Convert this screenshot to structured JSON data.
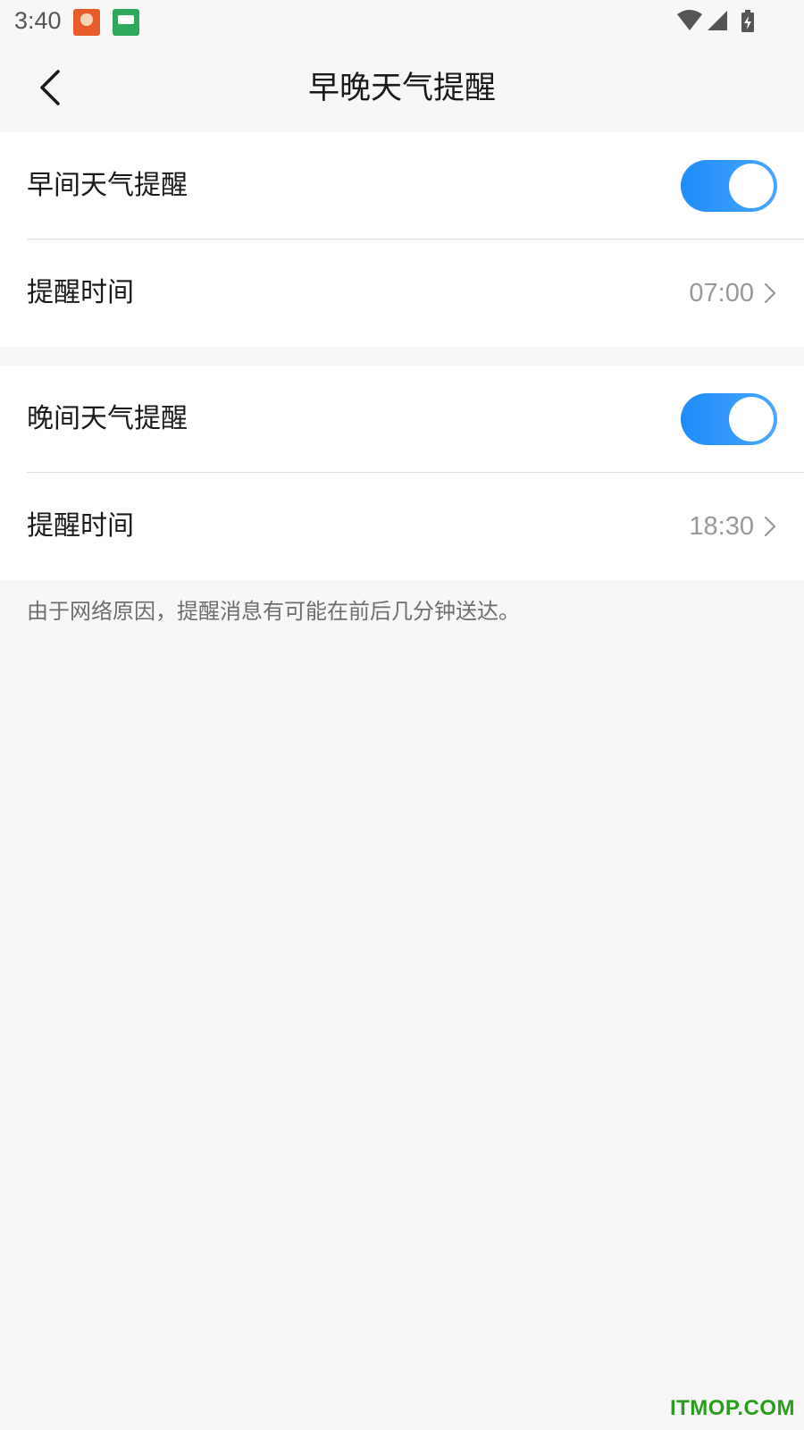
{
  "status_bar": {
    "time": "3:40",
    "app_icons": [
      "app-notification-icon",
      "app-notification-icon"
    ],
    "system_icons": [
      "wifi-icon",
      "cellular-signal-icon",
      "battery-charging-icon"
    ]
  },
  "nav": {
    "back_icon": "chevron-left-icon",
    "title": "早晚天气提醒"
  },
  "morning": {
    "label": "早间天气提醒",
    "enabled": true,
    "time_label": "提醒时间",
    "time_value": "07:00"
  },
  "evening": {
    "label": "晚间天气提醒",
    "enabled": true,
    "time_label": "提醒时间",
    "time_value": "18:30"
  },
  "footnote": "由于网络原因，提醒消息有可能在前后几分钟送达。",
  "watermark": "ITMOP.COM",
  "colors": {
    "accent": "#1e8cfa",
    "background": "#f7f7f7",
    "card": "#ffffff",
    "secondary_text": "#999999"
  }
}
